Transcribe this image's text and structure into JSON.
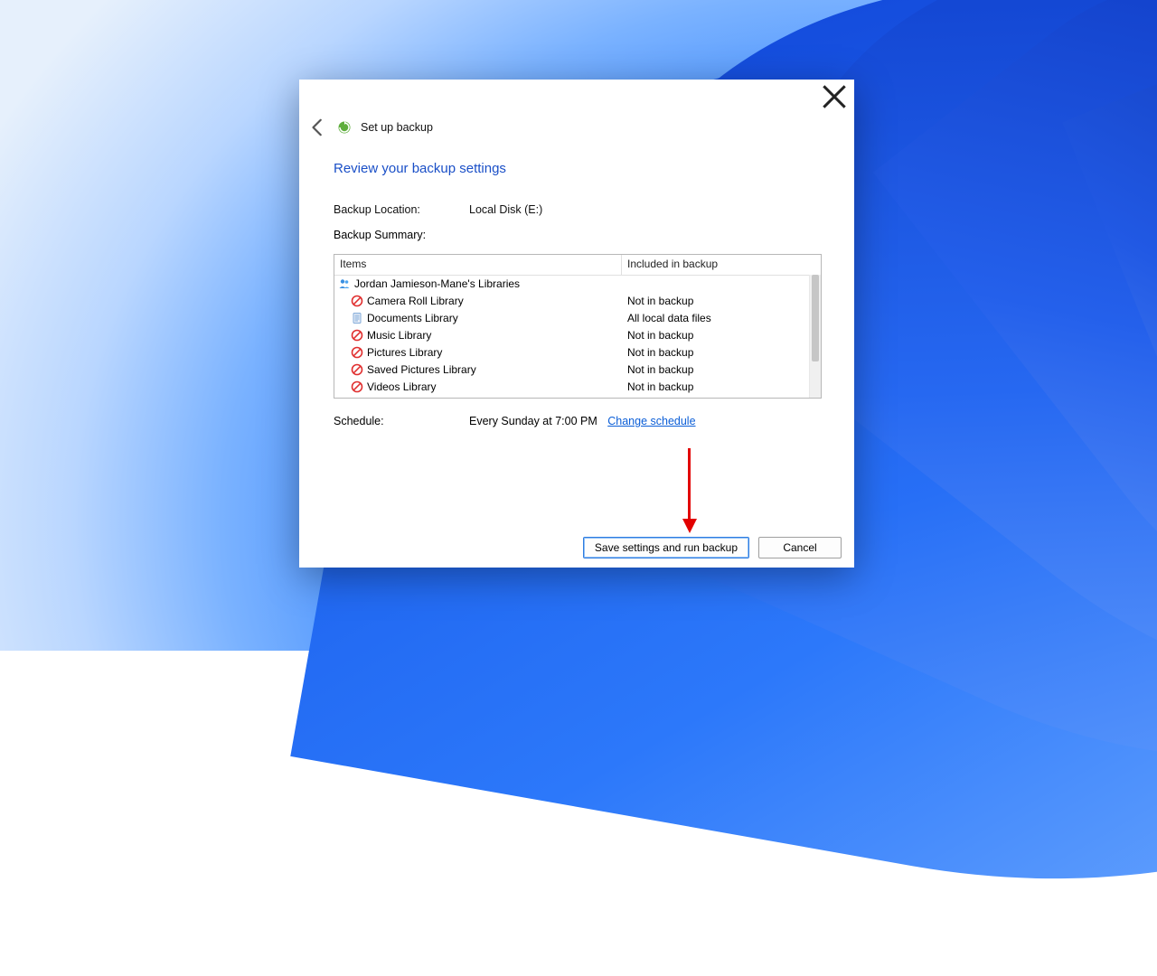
{
  "header": {
    "title": "Set up backup"
  },
  "page": {
    "title": "Review your backup settings",
    "location_label": "Backup Location:",
    "location_value": "Local Disk (E:)",
    "summary_label": "Backup Summary:",
    "schedule_label": "Schedule:",
    "schedule_value": "Every Sunday at 7:00 PM",
    "change_link": "Change schedule"
  },
  "grid": {
    "col_items": "Items",
    "col_included": "Included in backup",
    "rows": [
      {
        "icon": "people",
        "label": "Jordan Jamieson-Mane's Libraries",
        "included": "",
        "sub": false
      },
      {
        "icon": "no",
        "label": "Camera Roll Library",
        "included": "Not in backup",
        "sub": true
      },
      {
        "icon": "doc",
        "label": "Documents Library",
        "included": "All local data files",
        "sub": true
      },
      {
        "icon": "no",
        "label": "Music Library",
        "included": "Not in backup",
        "sub": true
      },
      {
        "icon": "no",
        "label": "Pictures Library",
        "included": "Not in backup",
        "sub": true
      },
      {
        "icon": "no",
        "label": "Saved Pictures Library",
        "included": "Not in backup",
        "sub": true
      },
      {
        "icon": "no",
        "label": "Videos Library",
        "included": "Not in backup",
        "sub": true
      }
    ]
  },
  "buttons": {
    "primary": "Save settings and run backup",
    "cancel": "Cancel"
  }
}
